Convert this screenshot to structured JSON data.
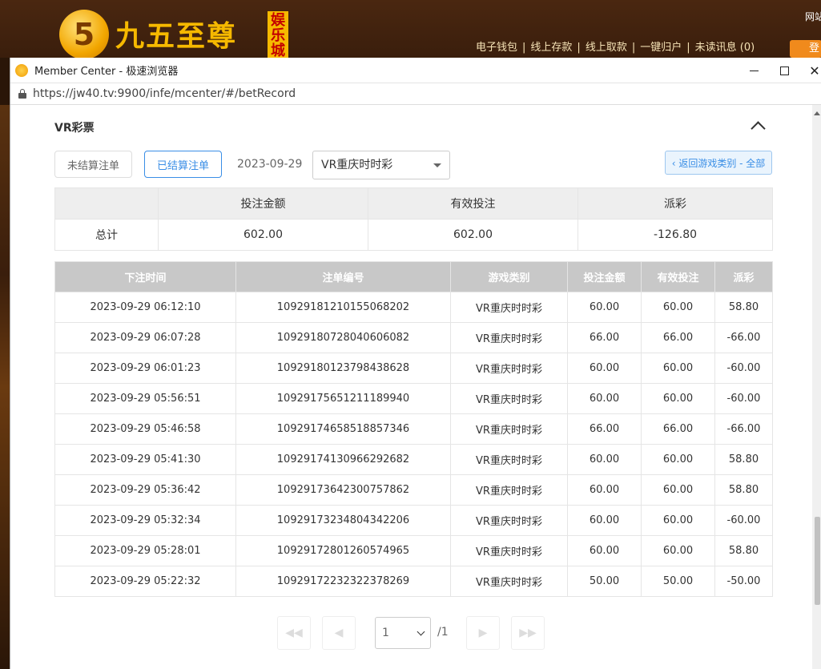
{
  "site": {
    "logo_char": "5",
    "logo_text": "九五至尊",
    "logo_badge": "娱乐城",
    "nav": [
      "电子钱包",
      "线上存款",
      "线上取款",
      "一键归户",
      "未读讯息 (0)"
    ],
    "top_right": "网站",
    "login": "登"
  },
  "browser": {
    "title": "Member Center - 极速浏览器",
    "url": "https://jw40.tv:9900/infe/mcenter/#/betRecord"
  },
  "page": {
    "section_title": "VR彩票",
    "tab_unsettled": "未结算注单",
    "tab_settled": "已结算注单",
    "date": "2023-09-29",
    "game_select": "VR重庆时时彩",
    "back_button": "‹ 返回游戏类别 - 全部"
  },
  "summary": {
    "headers": [
      "",
      "投注金额",
      "有效投注",
      "派彩"
    ],
    "label": "总计",
    "bet_amount": "602.00",
    "valid_bet": "602.00",
    "payout": "-126.80"
  },
  "records": {
    "headers": [
      "下注时间",
      "注单编号",
      "游戏类别",
      "投注金额",
      "有效投注",
      "派彩"
    ],
    "rows": [
      [
        "2023-09-29 06:12:10",
        "10929181210155068202",
        "VR重庆时时彩",
        "60.00",
        "60.00",
        "58.80"
      ],
      [
        "2023-09-29 06:07:28",
        "10929180728040606082",
        "VR重庆时时彩",
        "66.00",
        "66.00",
        "-66.00"
      ],
      [
        "2023-09-29 06:01:23",
        "10929180123798438628",
        "VR重庆时时彩",
        "60.00",
        "60.00",
        "-60.00"
      ],
      [
        "2023-09-29 05:56:51",
        "10929175651211189940",
        "VR重庆时时彩",
        "60.00",
        "60.00",
        "-60.00"
      ],
      [
        "2023-09-29 05:46:58",
        "10929174658518857346",
        "VR重庆时时彩",
        "66.00",
        "66.00",
        "-66.00"
      ],
      [
        "2023-09-29 05:41:30",
        "10929174130966292682",
        "VR重庆时时彩",
        "60.00",
        "60.00",
        "58.80"
      ],
      [
        "2023-09-29 05:36:42",
        "10929173642300757862",
        "VR重庆时时彩",
        "60.00",
        "60.00",
        "58.80"
      ],
      [
        "2023-09-29 05:32:34",
        "10929173234804342206",
        "VR重庆时时彩",
        "60.00",
        "60.00",
        "-60.00"
      ],
      [
        "2023-09-29 05:28:01",
        "10929172801260574965",
        "VR重庆时时彩",
        "60.00",
        "60.00",
        "58.80"
      ],
      [
        "2023-09-29 05:22:32",
        "10929172232322378269",
        "VR重庆时时彩",
        "50.00",
        "50.00",
        "-50.00"
      ]
    ]
  },
  "pager": {
    "first": "◀◀",
    "prev": "◀",
    "next": "▶",
    "last": "▶▶",
    "current": "1",
    "total": "/1"
  },
  "colors": {
    "accent": "#3a8ee6",
    "negative": "#e03c3c",
    "header_gray": "#c8c8c8"
  }
}
